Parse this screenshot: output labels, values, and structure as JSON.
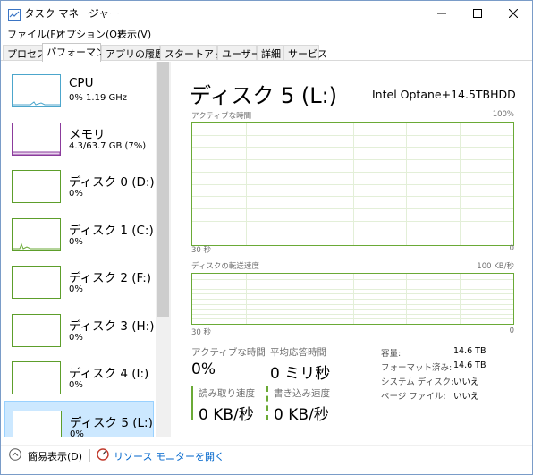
{
  "window": {
    "title": "タスク マネージャー"
  },
  "menu": [
    "ファイル(F)",
    "オプション(O)",
    "表示(V)"
  ],
  "tabs": [
    "プロセス",
    "パフォーマンス",
    "アプリの履歴",
    "スタートアップ",
    "ユーザー",
    "詳細",
    "サービス"
  ],
  "active_tab": "パフォーマンス",
  "sidebar": {
    "items": [
      {
        "name": "CPU",
        "detail": "0%  1.19 GHz",
        "type": "cpu"
      },
      {
        "name": "メモリ",
        "detail": "4.3/63.7 GB (7%)",
        "type": "memory"
      },
      {
        "name": "ディスク 0 (D:)",
        "detail": "0%",
        "type": "disk"
      },
      {
        "name": "ディスク 1 (C:)",
        "detail": "0%",
        "type": "disk"
      },
      {
        "name": "ディスク 2 (F:)",
        "detail": "0%",
        "type": "disk"
      },
      {
        "name": "ディスク 3 (H:)",
        "detail": "0%",
        "type": "disk"
      },
      {
        "name": "ディスク 4 (I:)",
        "detail": "0%",
        "type": "disk"
      },
      {
        "name": "ディスク 5 (L:)",
        "detail": "0%",
        "type": "disk",
        "selected": true
      }
    ]
  },
  "main": {
    "title": "ディスク 5 (L:)",
    "model": "Intel Optane+14.5TBHDD",
    "chart1": {
      "label": "アクティブな時間",
      "max": "100%",
      "time_left": "30 秒",
      "time_right": "0"
    },
    "chart2": {
      "label": "ディスクの転送速度",
      "max": "100 KB/秒",
      "time_left": "30 秒",
      "time_right": "0"
    },
    "stats": {
      "active_time_label": "アクティブな時間",
      "active_time_value": "0%",
      "response_label": "平均応答時間",
      "response_value": "0 ミリ秒",
      "read_label": "読み取り速度",
      "read_value": "0 KB/秒",
      "write_label": "書き込み速度",
      "write_value": "0 KB/秒"
    },
    "properties": [
      {
        "label": "容量:",
        "value": "14.6 TB"
      },
      {
        "label": "フォーマット済み:",
        "value": "14.6 TB"
      },
      {
        "label": "システム ディスク:",
        "value": "いいえ"
      },
      {
        "label": "ページ ファイル:",
        "value": "いいえ"
      }
    ]
  },
  "footer": {
    "fewer_details": "簡易表示(D)",
    "resource_monitor": "リソース モニターを開く"
  },
  "colors": {
    "disk": "#6aaa36",
    "cpu": "#4ca6cc",
    "memory": "#8b3b9c",
    "selected_bg": "#cce8ff",
    "link": "#0066cc"
  }
}
